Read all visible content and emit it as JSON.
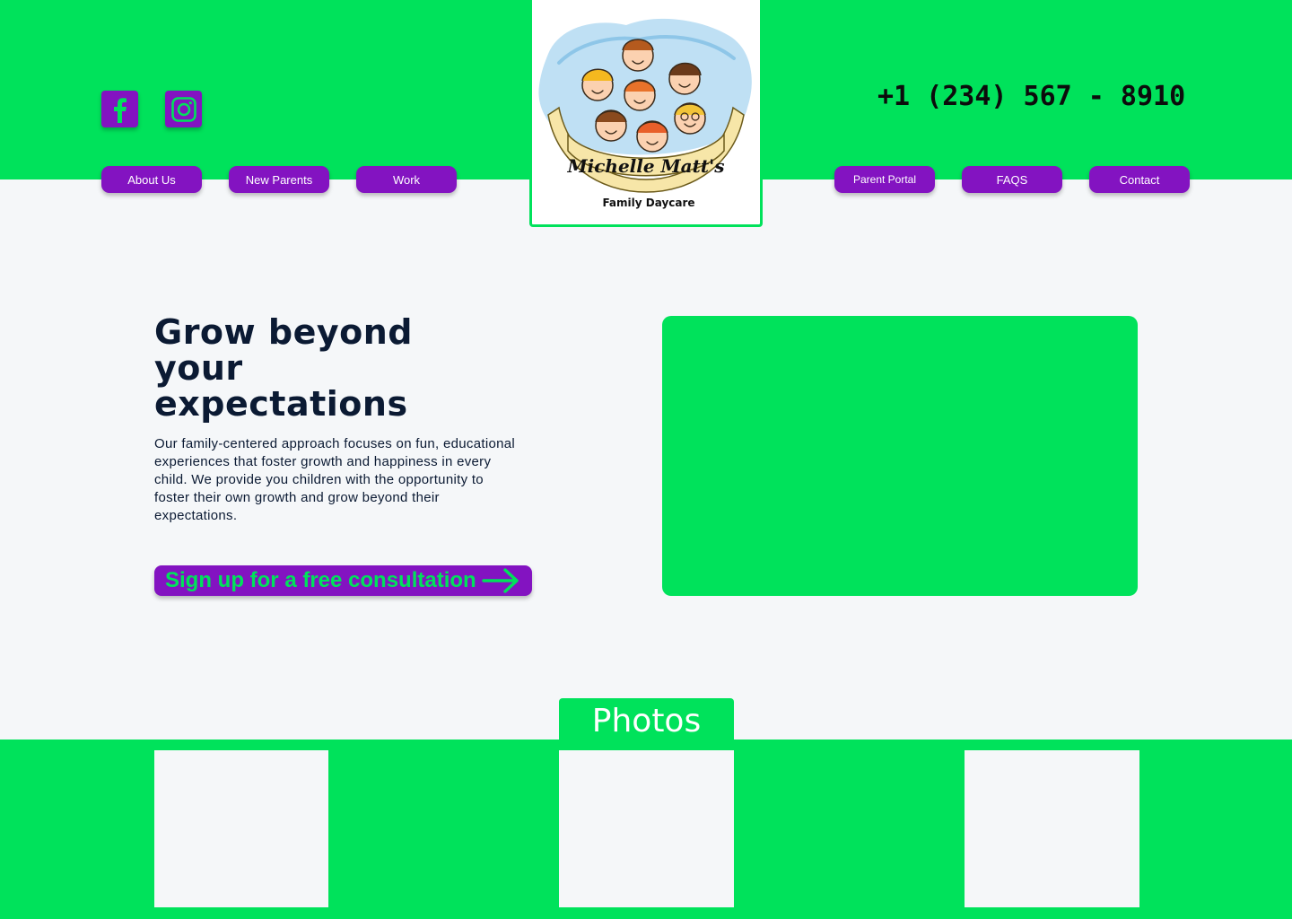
{
  "header": {
    "phone": "+1 (234) 567 - 8910",
    "social": [
      {
        "icon": "facebook-icon"
      },
      {
        "icon": "instagram-icon"
      }
    ],
    "nav_left": [
      "About Us",
      "New Parents",
      "Work"
    ],
    "nav_right": [
      "Parent Portal",
      "FAQS",
      "Contact"
    ],
    "logo": {
      "name_line": "Michelle Matt's",
      "sub_line": "Family Daycare"
    }
  },
  "hero": {
    "title": "Grow beyond your expectations",
    "body": "Our family-centered approach focuses on fun, educational experiences that foster growth and happiness in every child. We provide you children with the opportunity to foster their own growth and grow beyond their expectations.",
    "cta_label": "Sign up for a free consultation"
  },
  "photos": {
    "title": "Photos"
  },
  "colors": {
    "brand_green": "#00e25b",
    "brand_purple": "#8313c1",
    "background": "#f5f7f9",
    "text_dark": "#0b1a33"
  }
}
